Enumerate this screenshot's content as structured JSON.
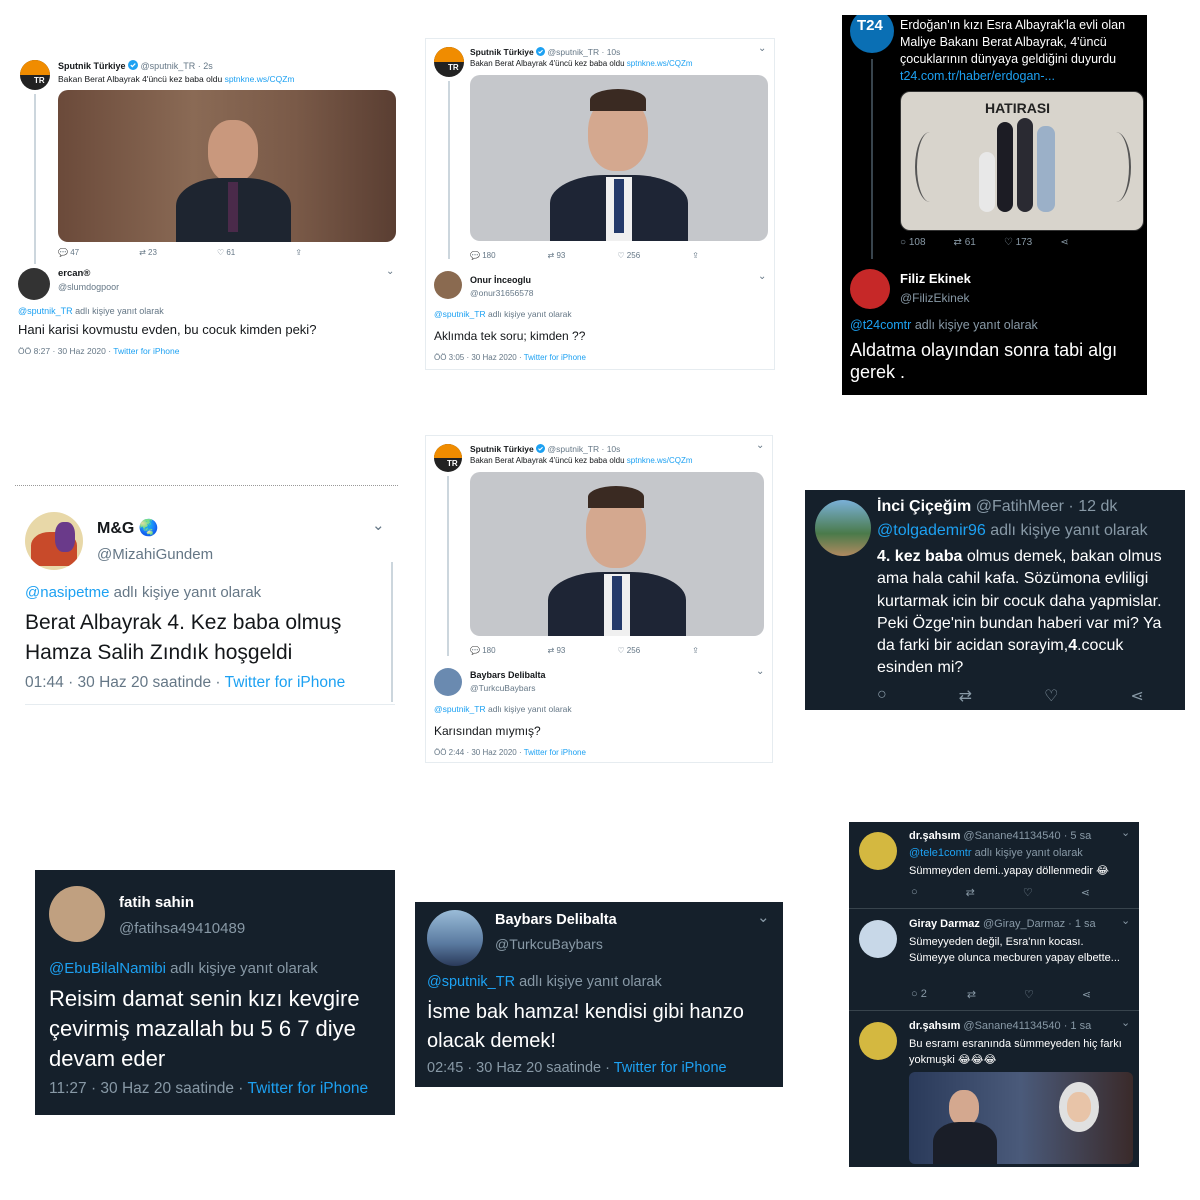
{
  "sputnik": {
    "name": "Sputnik Türkiye",
    "handle": "@sputnik_TR",
    "avatar_label": "TR",
    "text": "Bakan Berat Albayrak 4'üncü kez baba oldu",
    "link": "sptnkne.ws/CQZm",
    "time_a": "· 2s",
    "time_b": "· 10s"
  },
  "p1": {
    "stats": {
      "reply": "47",
      "retweet": "23",
      "like": "61"
    },
    "reply": {
      "name": "ercan®",
      "handle": "@slumdogpoor",
      "context_handle": "@sputnik_TR",
      "context_suffix": "adlı kişiye yanıt olarak",
      "text": "Hani karisi kovmustu evden, bu cocuk kimden peki?",
      "meta_time": "ÖÖ 8:27 · 30 Haz 2020 ·",
      "source": "Twitter for iPhone"
    }
  },
  "p2": {
    "stats": {
      "reply": "180",
      "retweet": "93",
      "like": "256"
    },
    "reply": {
      "name": "Onur İnceoglu",
      "handle": "@onur31656578",
      "context_handle": "@sputnik_TR",
      "context_suffix": "adlı kişiye yanıt olarak",
      "text": "Aklımda tek soru;  kimden ??",
      "meta_time": "ÖÖ 3:05 · 30 Haz 2020 ·",
      "source": "Twitter for iPhone"
    }
  },
  "p3": {
    "logo": "T24",
    "text": "Erdoğan'ın kızı Esra Albayrak'la evli olan Maliye Bakanı Berat Albayrak, 4'üncü çocuklarının dünyaya geldiğini duyurdu",
    "link": "t24.com.tr/haber/erdogan-...",
    "image_caption": "HATIRASI",
    "stats": {
      "reply": "108",
      "retweet": "61",
      "like": "173"
    },
    "reply": {
      "name": "Filiz Ekinek",
      "handle": "@FilizEkinek",
      "context_handle": "@t24comtr",
      "context_suffix": "adlı kişiye yanıt olarak",
      "text": "Aldatma olayından sonra tabi algı gerek ."
    }
  },
  "p4": {
    "name": "M&G",
    "handle": "@MizahiGundem",
    "context_handle": "@nasipetme",
    "context_suffix": "adlı kişiye yanıt olarak",
    "text": "Berat Albayrak 4. Kez baba olmuş Hamza Salih Zındık hoşgeldi",
    "meta_time": "01:44 · 30 Haz 20 saatinde ·",
    "source": "Twitter for iPhone"
  },
  "p5": {
    "stats": {
      "reply": "180",
      "retweet": "93",
      "like": "256"
    },
    "reply": {
      "name": "Baybars Delibalta",
      "handle": "@TurkcuBaybars",
      "context_handle": "@sputnik_TR",
      "context_suffix": "adlı kişiye yanıt olarak",
      "text": "Karısından mıymış?",
      "meta_time": "ÖÖ 2:44 · 30 Haz 2020 ·",
      "source": "Twitter for iPhone"
    }
  },
  "p6": {
    "name": "İnci Çiçeğim",
    "handle": "@FatihMeer",
    "time": "· 12 dk",
    "context_handle": "@tolgademir96",
    "context_suffix": "adlı kişiye yanıt olarak",
    "text_bold1": "4. kez baba",
    "text_part1": " olmus demek, bakan olmus ama hala  cahil kafa. Sözümona evliligi kurtarmak icin bir cocuk daha yapmislar. Peki Özge'nin bundan haberi var mi? Ya da farki bir acidan sorayim,",
    "text_bold2": "4",
    "text_part2": ".cocuk esinden mi?"
  },
  "p7": {
    "name": "fatih sahin",
    "handle": "@fatihsa49410489",
    "context_handle": "@EbuBilalNamibi",
    "context_suffix": "adlı kişiye yanıt olarak",
    "text": "Reisim damat senin kızı kevgire çevirmiş mazallah bu 5 6 7 diye devam eder",
    "meta_time": "11:27 · 30 Haz 20 saatinde ·",
    "source": "Twitter for iPhone"
  },
  "p8": {
    "name": "Baybars Delibalta",
    "handle": "@TurkcuBaybars",
    "context_handle": "@sputnik_TR",
    "context_suffix": "adlı kişiye yanıt olarak",
    "text": "İsme bak hamza! kendisi gibi hanzo olacak demek!",
    "meta_time": "02:45 · 30 Haz 20 saatinde ·",
    "source": "Twitter for iPhone"
  },
  "p9": {
    "t1": {
      "name": "dr.şahsım",
      "handle": "@Sanane41134540",
      "time": "· 5 sa",
      "context_handle": "@tele1comtr",
      "context_suffix": "adlı kişiye yanıt olarak",
      "text": "Sümmeyden demi..yapay döllenmedir 😂"
    },
    "t2": {
      "name": "Giray Darmaz",
      "handle": "@Giray_Darmaz",
      "time": "· 1 sa",
      "text": "Sümeyyeden değil, Esra'nın kocası. Sümeyye olunca mecburen yapay elbette...",
      "reply_count": "2"
    },
    "t3": {
      "name": "dr.şahsım",
      "handle": "@Sanane41134540",
      "time": "· 1 sa",
      "text": "Bu esramı esranında sümmeyeden hiç farkı yokmuşki 😂😂😂"
    }
  },
  "colors": {
    "twitter_blue": "#1da1f2",
    "dark_bg": "#15202b",
    "black_bg": "#000000",
    "light_text": "#14171a",
    "muted": "#657786",
    "verified": "#1da1f2",
    "t24_blue": "#0a6fb4"
  },
  "icons": [
    "reply-icon",
    "retweet-icon",
    "like-icon",
    "share-icon",
    "verified-icon",
    "chevron-down-icon"
  ]
}
